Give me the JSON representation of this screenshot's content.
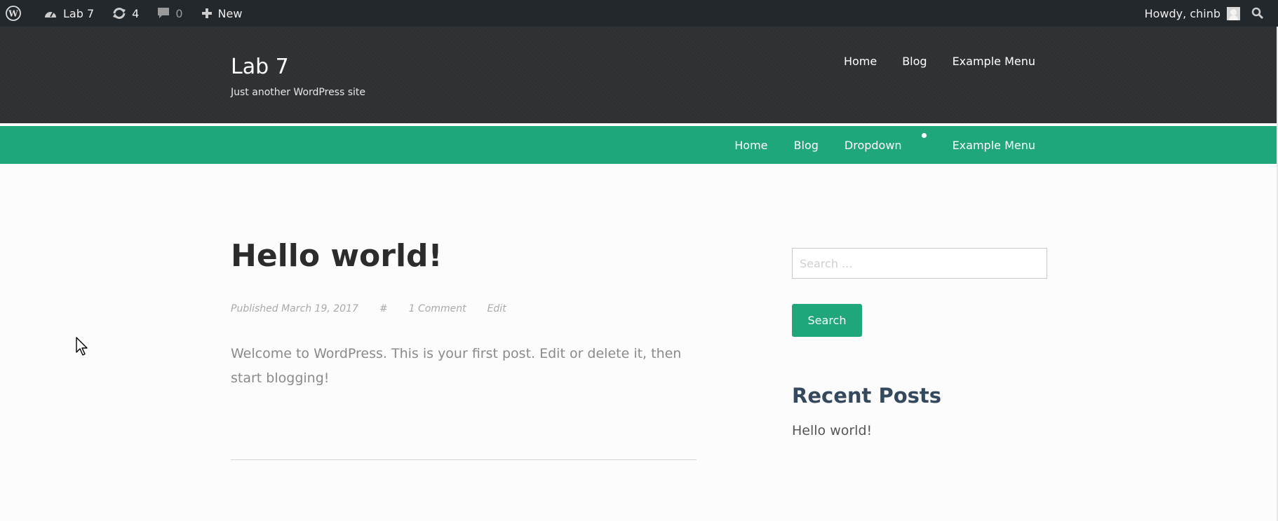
{
  "admin_bar": {
    "site_name": "Lab 7",
    "updates_count": "4",
    "comments_count": "0",
    "new_label": "New",
    "greeting": "Howdy, chinb"
  },
  "header": {
    "site_title": "Lab 7",
    "tagline": "Just another WordPress site",
    "top_menu": [
      "Home",
      "Blog",
      "Example Menu"
    ]
  },
  "secondary_menu": {
    "items": [
      "Home",
      "Blog",
      "Dropdown",
      "Example Menu"
    ]
  },
  "post": {
    "title": "Hello world!",
    "meta": {
      "published": "Published March 19, 2017",
      "permalink": "#",
      "comments": "1 Comment",
      "edit": "Edit"
    },
    "body": "Welcome to WordPress. This is your first post. Edit or delete it, then start blogging!"
  },
  "sidebar": {
    "search_placeholder": "Search ...",
    "search_button": "Search",
    "recent_posts_title": "Recent Posts",
    "recent_posts": [
      "Hello world!"
    ]
  },
  "colors": {
    "admin_bar": "#23282d",
    "header_bg": "#2e3134",
    "accent_green": "#1fa67a",
    "widget_title": "#34495e"
  },
  "icons": [
    "wordpress-logo-icon",
    "dashboard-icon",
    "updates-icon",
    "comment-icon",
    "plus-icon",
    "avatar",
    "search-icon",
    "mouse-cursor-icon"
  ]
}
